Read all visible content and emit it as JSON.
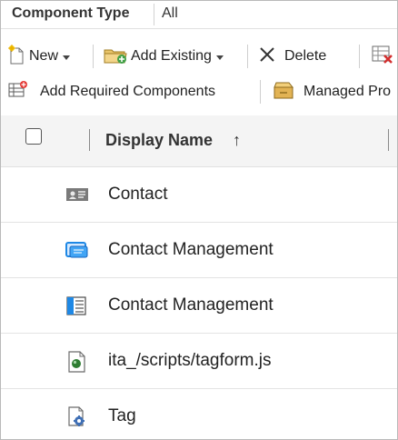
{
  "filter": {
    "label": "Component Type",
    "value": "All"
  },
  "toolbar": {
    "new_label": "New",
    "add_existing_label": "Add Existing",
    "delete_label": "Delete",
    "add_required_label": "Add Required Components",
    "managed_label": "Managed Pro"
  },
  "grid": {
    "column_title": "Display Name",
    "sort_indicator": "↑",
    "rows": [
      {
        "name": "Contact",
        "icon": "entity-contact-icon"
      },
      {
        "name": "Contact Management",
        "icon": "app-module-icon"
      },
      {
        "name": "Contact Management",
        "icon": "sitemap-icon"
      },
      {
        "name": "ita_/scripts/tagform.js",
        "icon": "web-resource-icon"
      },
      {
        "name": "Tag",
        "icon": "custom-entity-icon"
      }
    ]
  }
}
